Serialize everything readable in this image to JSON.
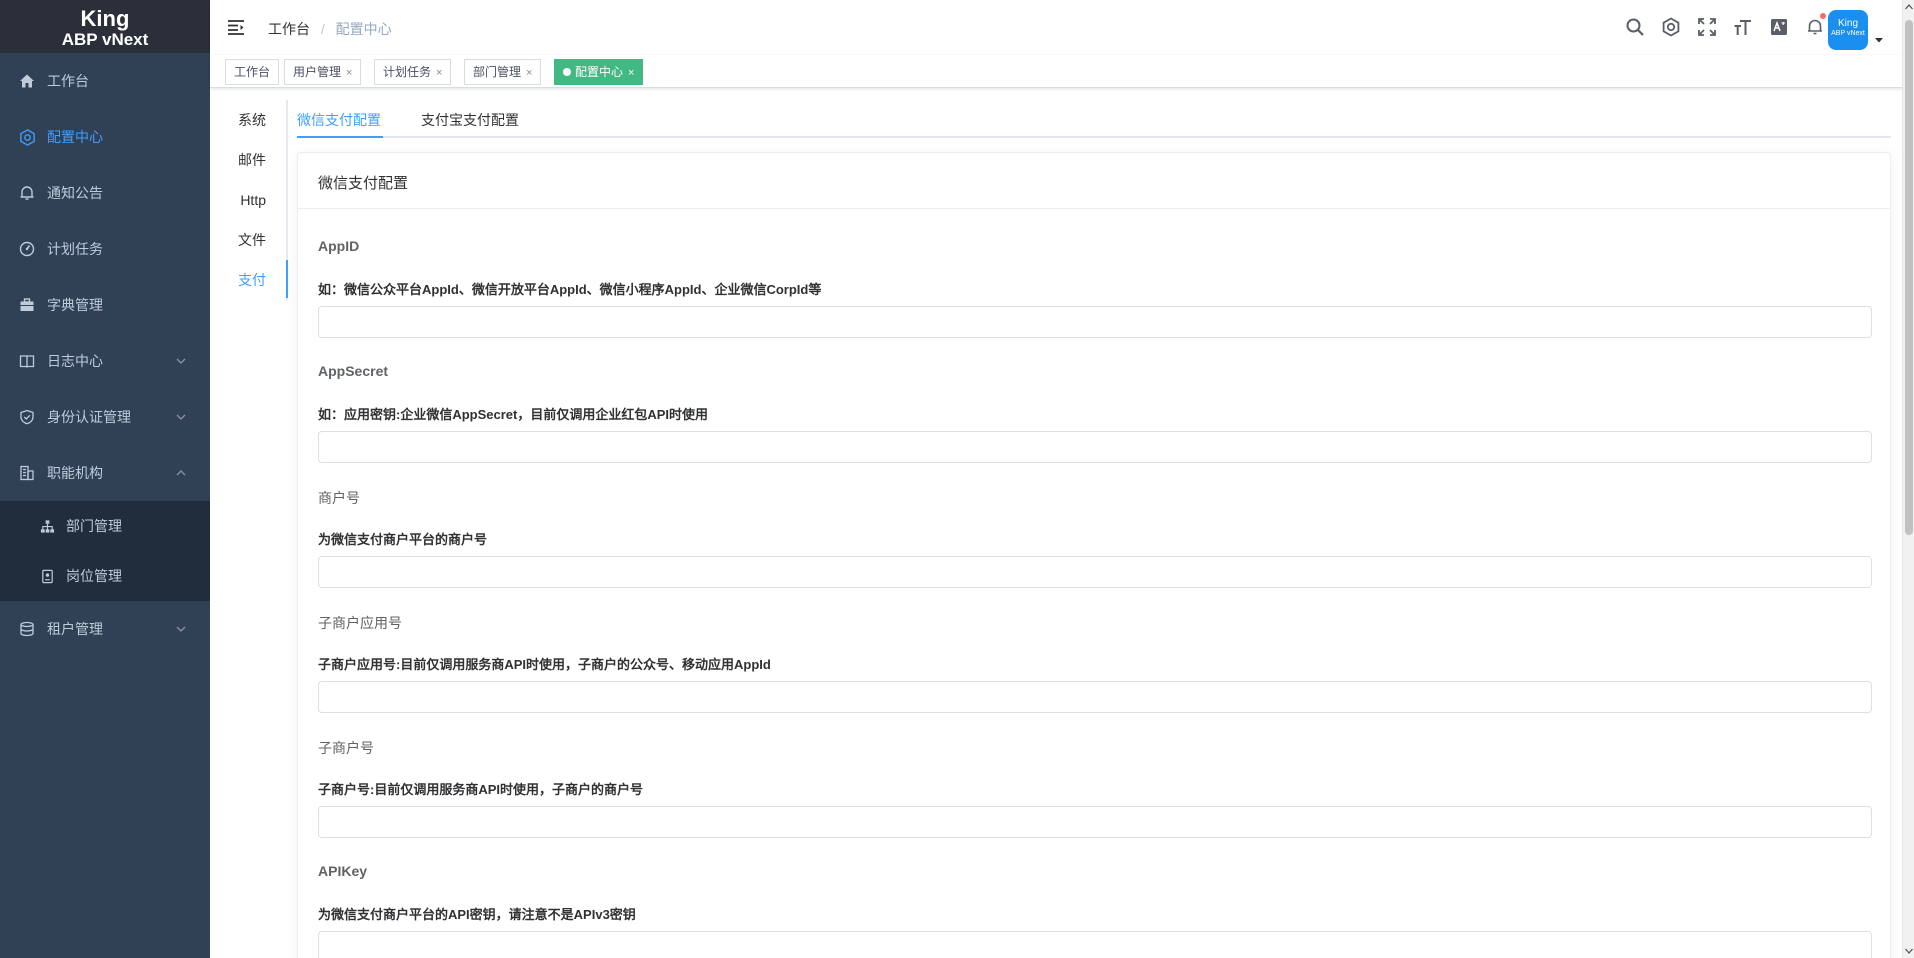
{
  "logo": {
    "line1": "King",
    "line2": "ABP vNext"
  },
  "sidebar": {
    "items": [
      {
        "label": "工作台",
        "icon": "home-icon"
      },
      {
        "label": "配置中心",
        "icon": "settings-icon"
      },
      {
        "label": "通知公告",
        "icon": "bell-icon"
      },
      {
        "label": "计划任务",
        "icon": "clock-icon"
      },
      {
        "label": "字典管理",
        "icon": "briefcase-icon"
      },
      {
        "label": "日志中心",
        "icon": "book-icon"
      },
      {
        "label": "身份认证管理",
        "icon": "shield-icon"
      },
      {
        "label": "职能机构",
        "icon": "building-icon"
      }
    ],
    "subitems": [
      {
        "label": "部门管理",
        "icon": "org-chart-icon"
      },
      {
        "label": "岗位管理",
        "icon": "badge-icon"
      }
    ],
    "tenant": {
      "label": "租户管理",
      "icon": "database-icon"
    }
  },
  "breadcrumb": {
    "first": "工作台",
    "sep": "/",
    "current": "配置中心"
  },
  "avatar": {
    "line1": "King",
    "line2": "ABP vNext"
  },
  "tags": [
    {
      "label": "工作台"
    },
    {
      "label": "用户管理",
      "close": "×"
    },
    {
      "label": "计划任务",
      "close": "×"
    },
    {
      "label": "部门管理",
      "close": "×"
    },
    {
      "label": "配置中心",
      "close": "×"
    }
  ],
  "settings_tabs": [
    "系统",
    "邮件",
    "Http",
    "文件",
    "支付"
  ],
  "pay_tabs": [
    "微信支付配置",
    "支付宝支付配置"
  ],
  "card": {
    "title": "微信支付配置",
    "fields": [
      {
        "label": "AppID",
        "desc": "如：微信公众平台AppId、微信开放平台AppId、微信小程序AppId、企业微信CorpId等",
        "value": ""
      },
      {
        "label": "AppSecret",
        "desc": "如：应用密钥:企业微信AppSecret，目前仅调用企业红包API时使用",
        "value": ""
      },
      {
        "label": "商户号",
        "desc": "为微信支付商户平台的商户号",
        "value": ""
      },
      {
        "label": "子商户应用号",
        "desc": "子商户应用号:目前仅调用服务商API时使用，子商户的公众号、移动应用AppId",
        "value": ""
      },
      {
        "label": "子商户号",
        "desc": "子商户号:目前仅调用服务商API时使用，子商户的商户号",
        "value": ""
      },
      {
        "label": "APIKey",
        "desc": "为微信支付商户平台的API密钥，请注意不是APIv3密钥",
        "value": ""
      }
    ]
  },
  "colors": {
    "sidebar_bg": "#304156",
    "accent": "#409eff",
    "active_tag": "#42b983",
    "notification_dot": "#f56c6c"
  }
}
